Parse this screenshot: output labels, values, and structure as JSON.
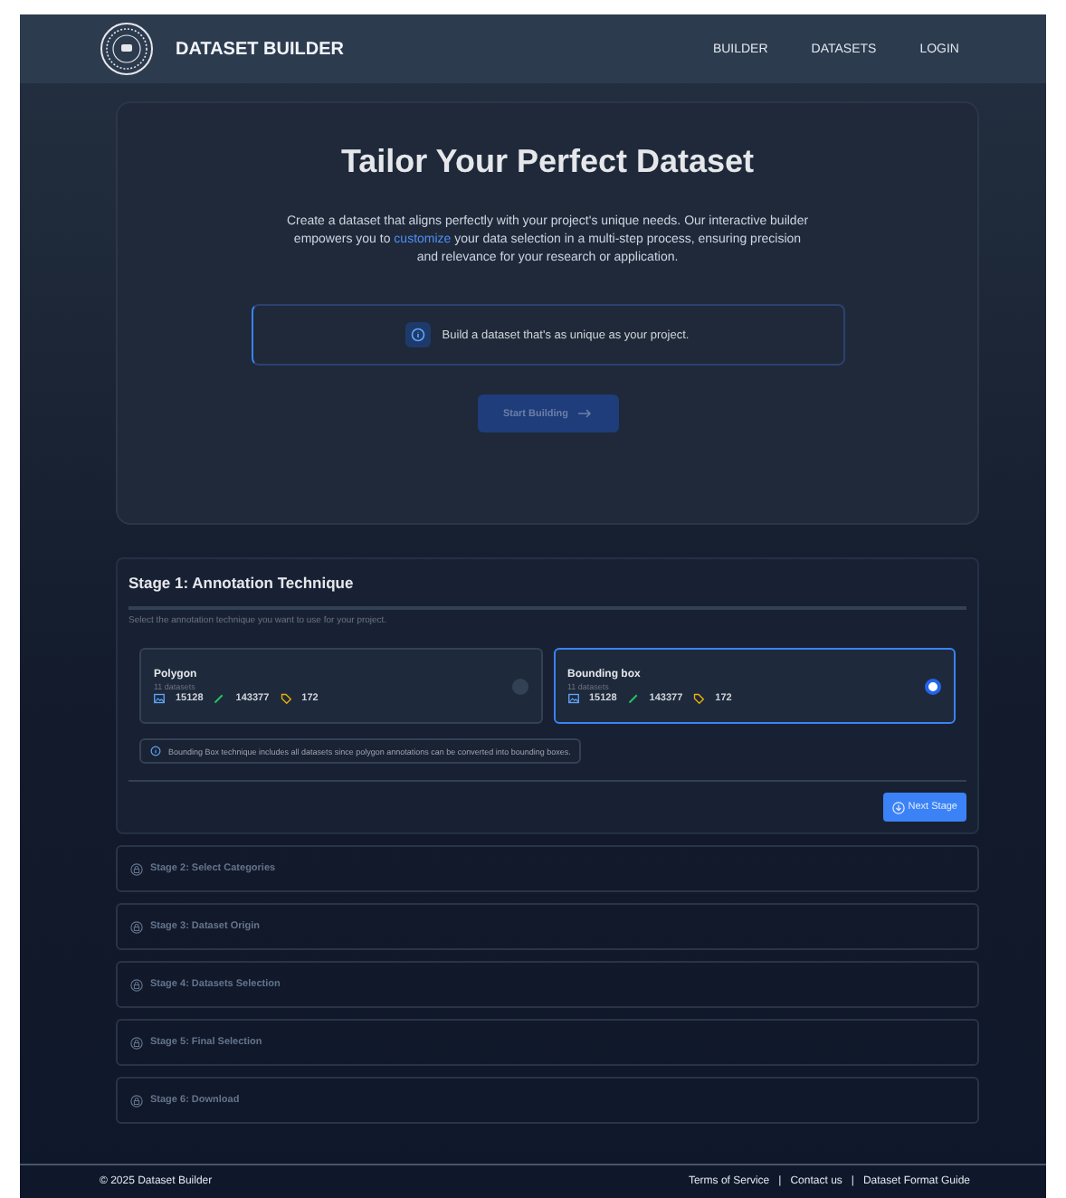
{
  "header": {
    "brand": "DATASET BUILDER",
    "nav": [
      {
        "label": "BUILDER"
      },
      {
        "label": "DATASETS"
      },
      {
        "label": "LOGIN"
      }
    ]
  },
  "hero": {
    "title": "Tailor Your Perfect Dataset",
    "description": "Create a dataset that aligns perfectly with your project's unique needs. Our interactive builder empowers you to **customize** your data selection in a multi-step process, ensuring precision and relevance for your research or application.",
    "callout": "Build a dataset that's as unique as your project.",
    "button": "Start Building",
    "button_disabled": true
  },
  "stage1": {
    "title": "Stage 1: Annotation Technique",
    "subtitle": "Select the annotation technique you want to use for your project.",
    "options": [
      {
        "name": "Polygon",
        "count": "11 datasets",
        "images": "15128",
        "annotations": "143377",
        "categories": "172",
        "selected": false
      },
      {
        "name": "Bounding box",
        "count": "11 datasets",
        "images": "15128",
        "annotations": "143377",
        "categories": "172",
        "selected": true
      }
    ],
    "note": "Bounding Box technique includes all datasets since polygon annotations can be converted into bounding boxes.",
    "next": "Next Stage"
  },
  "stages": [
    {
      "title": "Stage 2: Select Categories"
    },
    {
      "title": "Stage 3: Dataset Origin"
    },
    {
      "title": "Stage 4: Datasets Selection"
    },
    {
      "title": "Stage 5: Final Selection"
    },
    {
      "title": "Stage 6: Download"
    }
  ],
  "footer": {
    "copyright": "© 2025 Dataset Builder",
    "separator": "|",
    "links": [
      {
        "label": "Terms of Service"
      },
      {
        "label": "Contact us"
      },
      {
        "label": "Dataset Format Guide"
      }
    ]
  }
}
